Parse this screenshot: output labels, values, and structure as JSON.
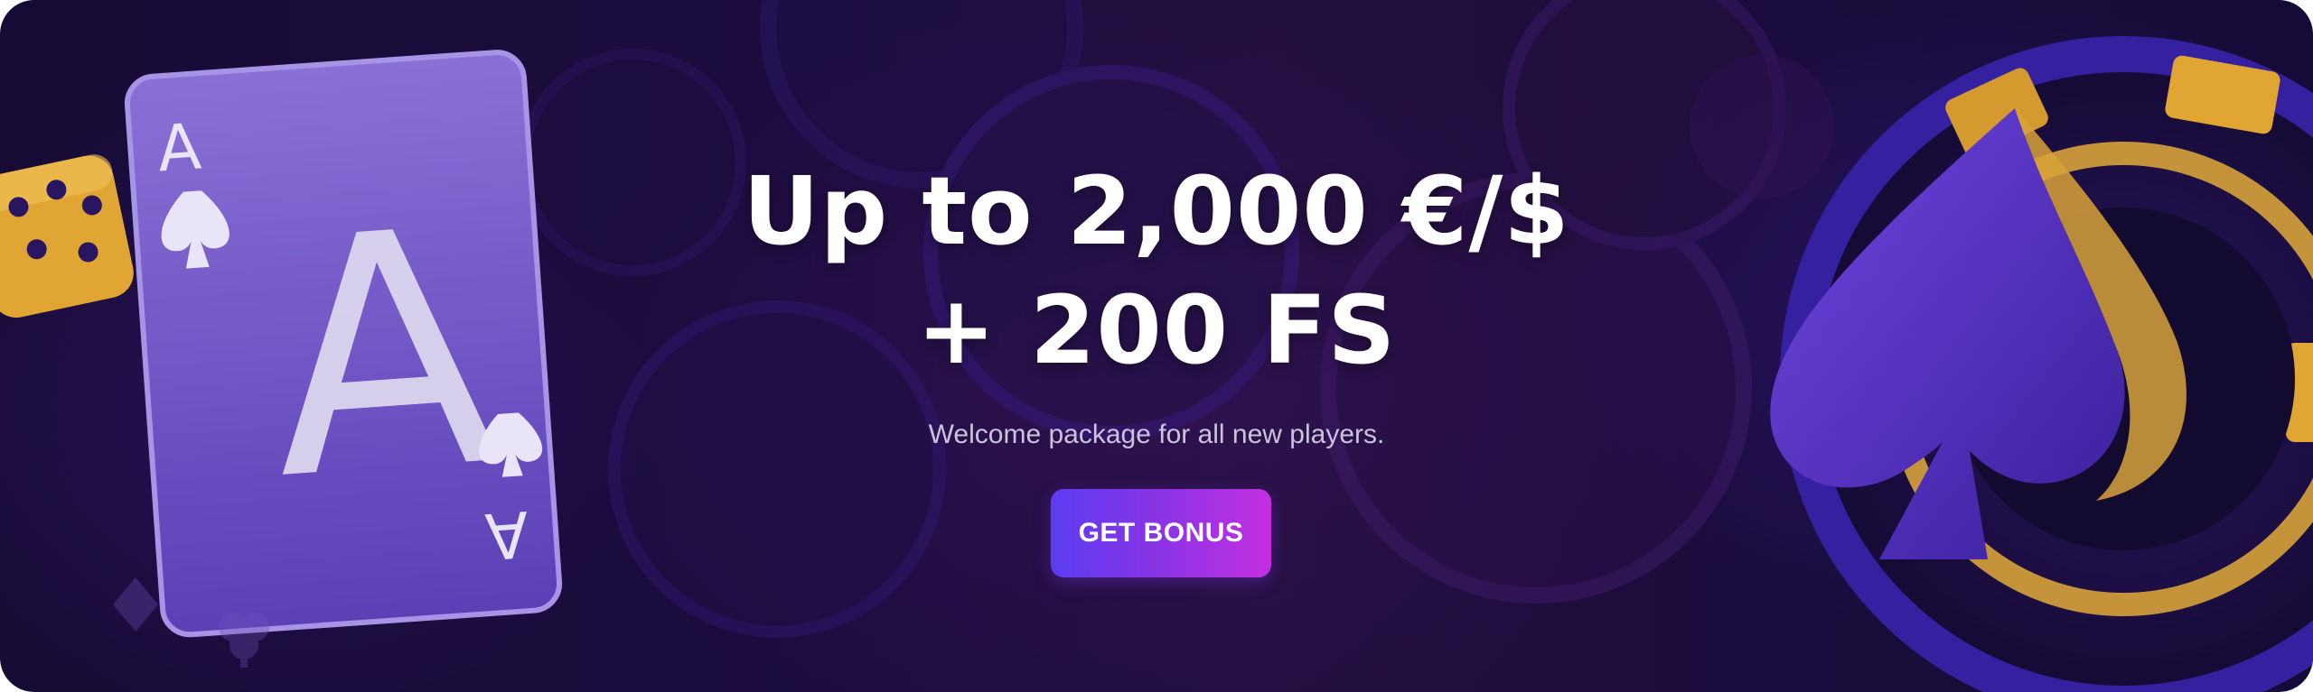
{
  "banner": {
    "headline_line1": "Up to 2,000 €/$",
    "headline_line2": "+ 200 FS",
    "subtitle": "Welcome package for all new players.",
    "cta_label": "GET BONUS",
    "card_rank": "A",
    "colors": {
      "background": "#1b0c3e",
      "cta_start": "#5b3cf0",
      "cta_end": "#c42fe0",
      "card": "#7258c9",
      "gold": "#e0a532"
    }
  }
}
